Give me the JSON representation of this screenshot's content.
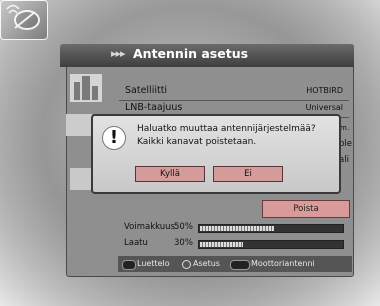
{
  "screen": {
    "title": "Antennin asetus",
    "title_arrows": "▸▸▸",
    "rows": [
      {
        "label": "Satelliitti",
        "value": "HOTBIRD"
      },
      {
        "label": "LNB-taajuus",
        "value": "Universal"
      }
    ],
    "partial_values": [
      "m.",
      "ble",
      "ali"
    ],
    "delete_label": "Poista",
    "signal": [
      {
        "label": "Voimakkuus",
        "value": "50%",
        "level": 0.52
      },
      {
        "label": "Laatu",
        "value": "30%",
        "level": 0.3
      }
    ],
    "footer": {
      "list": "Luettelo",
      "setting": "Asetus",
      "motor": "Moottoriantenni"
    }
  },
  "dialog": {
    "warning_glyph": "!",
    "line1": "Haluatko muuttaa antennijärjestelmää?",
    "line2": "Kaikki kanavat poistetaan.",
    "yes_label": "Kyllä",
    "no_label": "Ei"
  },
  "colors": {
    "header": "#4a4a4a",
    "button": "#d49b9b",
    "dialog": "#d6d6d6"
  }
}
